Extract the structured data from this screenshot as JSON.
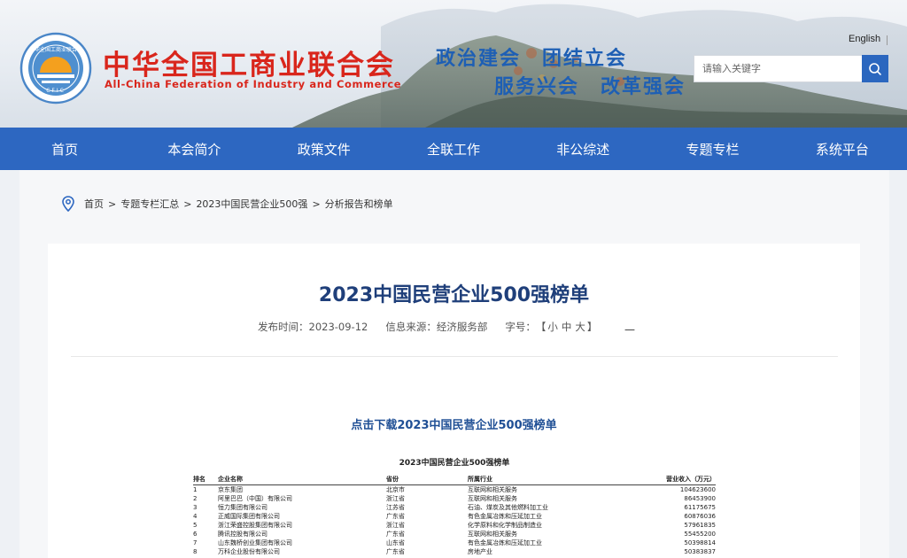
{
  "header": {
    "org_name_cn": "中华全国工商业联合会",
    "org_name_en": "All-China Federation of Industry and Commerce",
    "seal_text": "中华全国工商业联合会",
    "seal_abbr": "CFIC",
    "slogan_line1": "政治建会　团结立会",
    "slogan_line2": "服务兴会　改革强会",
    "lang_link": "English",
    "search_placeholder": "请输入关键字"
  },
  "nav": {
    "items": [
      "首页",
      "本会简介",
      "政策文件",
      "全联工作",
      "非公综述",
      "专题专栏",
      "系统平台"
    ]
  },
  "breadcrumb": {
    "items": [
      "首页",
      "专题专栏汇总",
      "2023中国民营企业500强",
      "分析报告和榜单"
    ],
    "separator": ">"
  },
  "article": {
    "title": "2023中国民营企业500强榜单",
    "publish_label": "发布时间：",
    "publish_date": "2023-09-12",
    "source_label": "信息来源：",
    "source": "经济服务部",
    "fontsize_label": "字号：",
    "bracket_open": "【",
    "bracket_close": "】",
    "fontsize_small": "小",
    "fontsize_medium": "中",
    "fontsize_large": "大",
    "dash": "—",
    "download_link": "点击下载2023中国民营企业500强榜单"
  },
  "table": {
    "title": "2023中国民营企业500强榜单",
    "headers": [
      "排名",
      "企业名称",
      "省份",
      "所属行业",
      "营业收入（万元）"
    ],
    "rows": [
      [
        "1",
        "京东集团",
        "北京市",
        "互联网和相关服务",
        "104623600"
      ],
      [
        "2",
        "阿里巴巴（中国）有限公司",
        "浙江省",
        "互联网和相关服务",
        "86453900"
      ],
      [
        "3",
        "恒力集团有限公司",
        "江苏省",
        "石油、煤炭及其他燃料加工业",
        "61175675"
      ],
      [
        "4",
        "正威国际集团有限公司",
        "广东省",
        "有色金属冶炼和压延加工业",
        "60876036"
      ],
      [
        "5",
        "浙江荣盛控股集团有限公司",
        "浙江省",
        "化学原料和化学制品制造业",
        "57961835"
      ],
      [
        "6",
        "腾讯控股有限公司",
        "广东省",
        "互联网和相关服务",
        "55455200"
      ],
      [
        "7",
        "山东魏桥创业集团有限公司",
        "山东省",
        "有色金属冶炼和压延加工业",
        "50398814"
      ],
      [
        "8",
        "万科企业股份有限公司",
        "广东省",
        "房地产业",
        "50383837"
      ]
    ]
  },
  "colors": {
    "nav_blue": "#2d67c1",
    "brand_red": "#d9261c",
    "slogan_blue": "#1e5fb4",
    "title_blue": "#1f3f7a"
  }
}
